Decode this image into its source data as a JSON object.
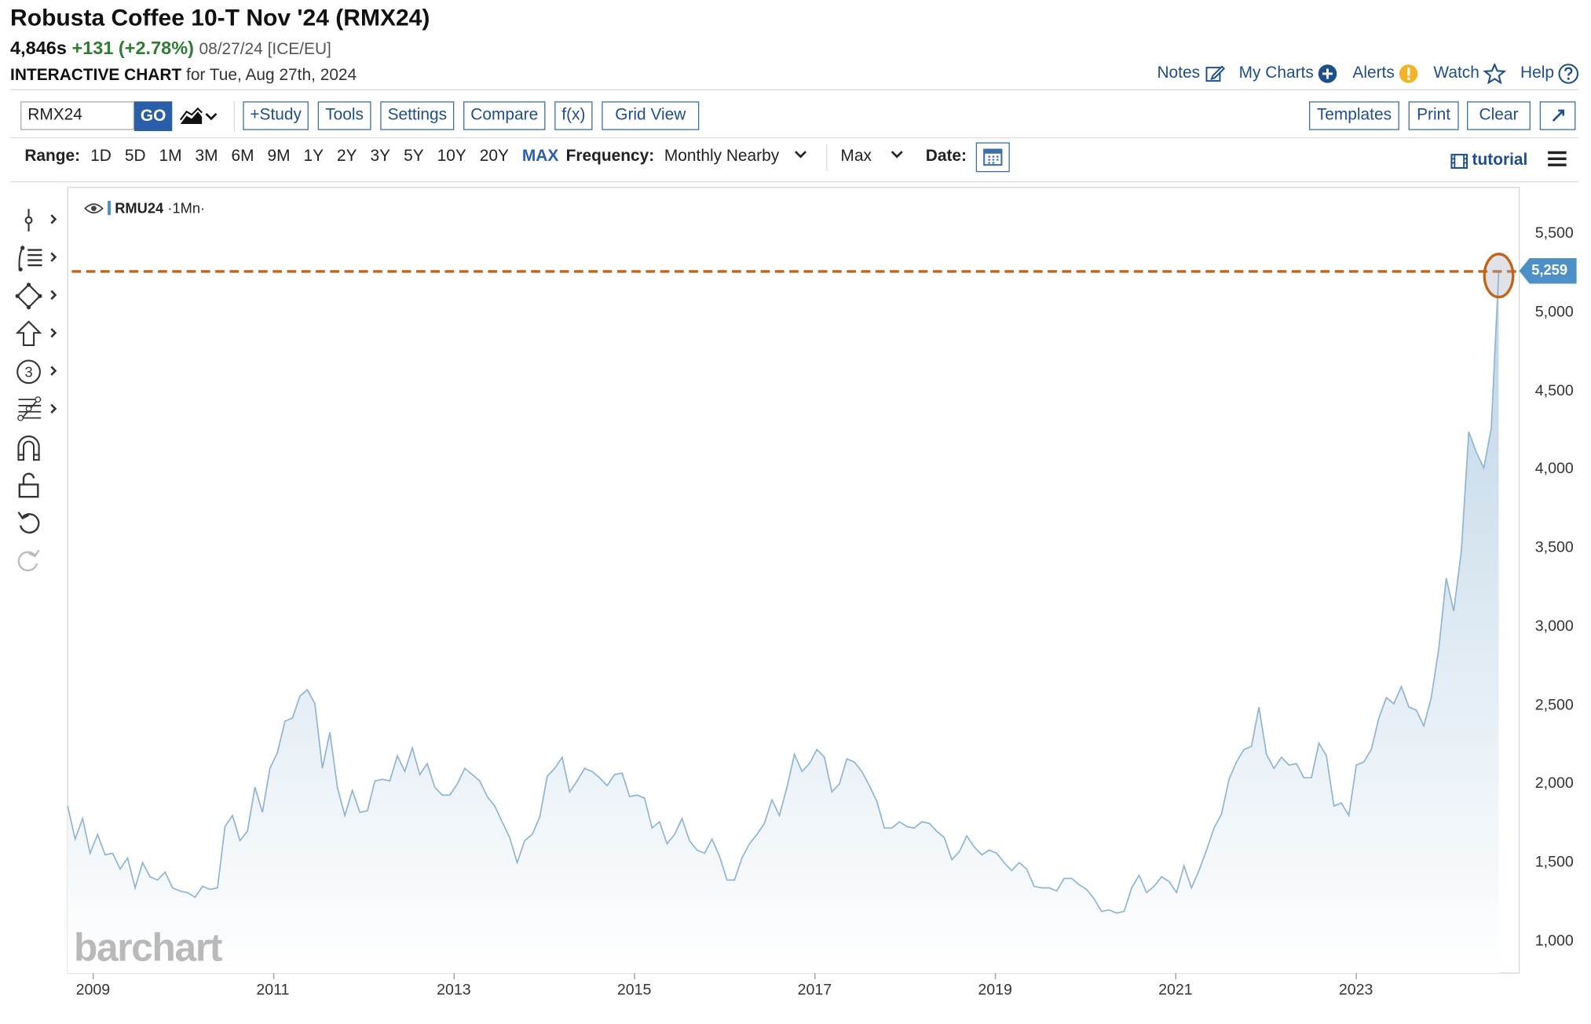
{
  "header": {
    "title": "Robusta Coffee 10-T Nov '24 (RMX24)",
    "last": "4,846s",
    "change": "+131 (+2.78%)",
    "meta": "08/27/24 [ICE/EU]",
    "chart_label": "INTERACTIVE CHART",
    "chart_date": "for Tue, Aug 27th, 2024"
  },
  "toplinks": [
    {
      "label": "Notes",
      "icon": "pencil-square-icon"
    },
    {
      "label": "My Charts",
      "icon": "plus-circle-icon"
    },
    {
      "label": "Alerts",
      "icon": "alert-icon"
    },
    {
      "label": "Watch",
      "icon": "star-icon"
    },
    {
      "label": "Help",
      "icon": "help-icon"
    }
  ],
  "toolbar": {
    "symbol": "RMX24",
    "go": "GO",
    "study": "+Study",
    "tools": "Tools",
    "settings": "Settings",
    "compare": "Compare",
    "fx": "f(x)",
    "grid_view": "Grid View",
    "templates": "Templates",
    "print": "Print",
    "clear": "Clear"
  },
  "rangebar": {
    "label": "Range:",
    "ranges": [
      "1D",
      "5D",
      "1M",
      "3M",
      "6M",
      "9M",
      "1Y",
      "2Y",
      "3Y",
      "5Y",
      "10Y",
      "20Y",
      "MAX"
    ],
    "active": "MAX",
    "frequency_label": "Frequency:",
    "frequency": "Monthly Nearby",
    "period": "Max",
    "date_label": "Date:",
    "tutorial": "tutorial"
  },
  "legend": {
    "symbol": "RMU24",
    "period": "·1Mn·"
  },
  "watermark": "barchart",
  "colors": {
    "line": "#8fb4d4",
    "fill_top": "#bcd4e6",
    "fill_bottom": "#ffffff",
    "hline": "#c0651c",
    "tag": "#4f8fc7",
    "link": "#1f4e8c"
  },
  "chart_data": {
    "type": "area",
    "series": [
      {
        "name": "RMU24",
        "x_start": "2008-11",
        "x_step": "1 month",
        "values": [
          1860,
          1650,
          1780,
          1560,
          1680,
          1550,
          1560,
          1460,
          1530,
          1340,
          1500,
          1410,
          1390,
          1440,
          1340,
          1320,
          1310,
          1280,
          1350,
          1330,
          1340,
          1730,
          1800,
          1640,
          1700,
          1980,
          1820,
          2100,
          2200,
          2400,
          2420,
          2560,
          2600,
          2510,
          2100,
          2330,
          1980,
          1800,
          1960,
          1820,
          1830,
          2020,
          2030,
          2020,
          2180,
          2080,
          2230,
          2060,
          2130,
          1980,
          1930,
          1930,
          2000,
          2100,
          2060,
          2020,
          1920,
          1860,
          1760,
          1660,
          1500,
          1640,
          1680,
          1790,
          2050,
          2100,
          2170,
          1950,
          2020,
          2100,
          2080,
          2040,
          1990,
          2060,
          2070,
          1920,
          1930,
          1910,
          1720,
          1760,
          1620,
          1680,
          1780,
          1640,
          1580,
          1560,
          1650,
          1540,
          1390,
          1390,
          1530,
          1620,
          1680,
          1750,
          1900,
          1800,
          1980,
          2190,
          2080,
          2130,
          2220,
          2170,
          1950,
          2000,
          2160,
          2140,
          2080,
          1990,
          1890,
          1720,
          1720,
          1760,
          1730,
          1720,
          1760,
          1750,
          1700,
          1660,
          1520,
          1570,
          1670,
          1600,
          1550,
          1580,
          1560,
          1500,
          1450,
          1500,
          1460,
          1350,
          1340,
          1340,
          1320,
          1400,
          1400,
          1360,
          1330,
          1270,
          1190,
          1200,
          1180,
          1190,
          1340,
          1420,
          1310,
          1350,
          1410,
          1380,
          1310,
          1480,
          1340,
          1450,
          1580,
          1720,
          1810,
          2030,
          2140,
          2220,
          2240,
          2490,
          2190,
          2100,
          2170,
          2120,
          2130,
          2040,
          2040,
          2260,
          2180,
          1860,
          1880,
          1800,
          2120,
          2140,
          2220,
          2420,
          2550,
          2510,
          2620,
          2490,
          2470,
          2370,
          2550,
          2860,
          3310,
          3100,
          3480,
          4240,
          4110,
          4010,
          4260,
          5259
        ]
      }
    ],
    "last_value": 5259,
    "last_value_label": "5,259",
    "x_tick_labels": [
      "2009",
      "2011",
      "2013",
      "2015",
      "2017",
      "2019",
      "2021",
      "2023"
    ],
    "y_tick_labels": [
      "1,000",
      "1,500",
      "2,000",
      "2,500",
      "3,000",
      "3,500",
      "4,000",
      "4,500",
      "5,000",
      "5,500"
    ],
    "ylim": [
      1000,
      5500
    ],
    "grid": false,
    "y_axis_side": "right"
  }
}
